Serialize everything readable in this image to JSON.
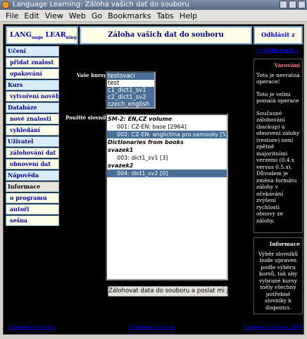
{
  "window": {
    "title": "Language Learning: Záloha vašich dat do souboru"
  },
  "menu": {
    "items": [
      "File",
      "Edit",
      "View",
      "Web",
      "Go",
      "Bookmarks",
      "Tabs",
      "Help"
    ]
  },
  "header": {
    "logo_lang": "LANG",
    "logo_sub1": "uage",
    "logo_lear": "LEAR",
    "logo_sub2": "ning",
    "title": "Záloha vašich dat do souboru",
    "logout": "Odhlásit z účtu test"
  },
  "nav": {
    "items": [
      {
        "label": "Učení",
        "kind": "section"
      },
      {
        "label": "přidat znalost",
        "kind": "sub"
      },
      {
        "label": "opakování",
        "kind": "sub"
      },
      {
        "label": "Kurs",
        "kind": "section"
      },
      {
        "label": "vytvoření nového",
        "kind": "sub"
      },
      {
        "label": "Databáze",
        "kind": "section"
      },
      {
        "label": "nové znalosti",
        "kind": "sub"
      },
      {
        "label": "vyhledání",
        "kind": "sub"
      },
      {
        "label": "Uživatel",
        "kind": "section"
      },
      {
        "label": "zálohování dat",
        "kind": "sub"
      },
      {
        "label": "obnovení dat",
        "kind": "sub"
      },
      {
        "label": "Nápověda",
        "kind": "section"
      },
      {
        "label": "Informace",
        "kind": "plain"
      },
      {
        "label": "o programu",
        "kind": "sub"
      },
      {
        "label": "autoři",
        "kind": "sub"
      },
      {
        "label": "sešna",
        "kind": "sub"
      }
    ]
  },
  "form": {
    "courses_label": "Vaše kursy:",
    "courses": [
      {
        "label": "testovaci",
        "selected": true
      },
      {
        "label": "test",
        "selected": false
      },
      {
        "label": "c1_dict1_sv1",
        "selected": true
      },
      {
        "label": "c2_dict1_sv2",
        "selected": true
      },
      {
        "label": "czech_english",
        "selected": true
      }
    ],
    "dicts_label": "Použité slovníky:",
    "dict_groups": [
      {
        "label": "SM-2: EN,CZ volume",
        "options": [
          {
            "label": "001: CZ-EN: base [2964]",
            "selected": false
          },
          {
            "label": "002: CZ-EN: anglictina pro samouky [524]",
            "selected": true
          }
        ]
      },
      {
        "label": "Dictionaries from books",
        "options": []
      },
      {
        "label": "svazek1",
        "options": [
          {
            "label": "003: dict1_sv1 [3]",
            "selected": false
          }
        ]
      },
      {
        "label": "svazek2",
        "options": [
          {
            "label": "004: dict1_sv2 [0]",
            "selected": true
          }
        ]
      }
    ],
    "submit_label": "Zálohovat data do souboru a poslat mi jej"
  },
  "sidebar": {
    "top_link": "Language Learning",
    "warning_title": "Varování",
    "warning_paragraphs": [
      "Toto je nevratná operace!",
      "Toto je velmi pomalá operace",
      "Současné zálohování (backup) a obnovení zálohy (restore) není zpětně majoritními verzemi (0.4.x versus 0.5.x). Důvodem je změna formátu zálohy v očekávání zvýšení rychlosti obnovy ze zálohy."
    ],
    "info_title": "Informace",
    "info_text": "Výběr slovníků bude upraven podle výběru kursů, tak aby vybrané kursy měly všechny potřebné slovníky k dispozici."
  },
  "footer": {
    "left": "Language Learning",
    "center": "Language Learning",
    "right": "Language Learning, 2004"
  }
}
